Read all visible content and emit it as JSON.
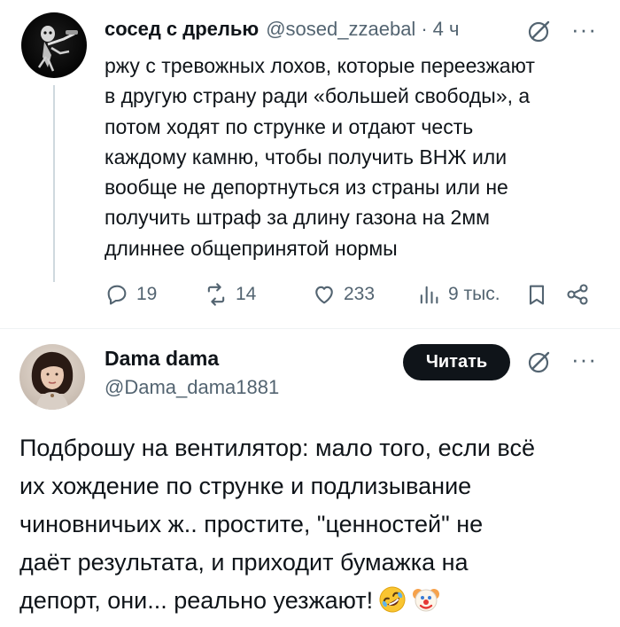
{
  "tweet1": {
    "author_name": "сосед с дрелью",
    "author_handle": "@sosed_zzaebal",
    "separator": "·",
    "time": "4 ч",
    "more_icon": "more-horizontal-icon",
    "grok_icon": "grok-icon",
    "text_lines": [
      "ржу с тревожных лохов, которые переезжают",
      "в другую страну ради «большей свободы», а",
      "потом ходят по струнке и отдают честь",
      "каждому камню, чтобы получить ВНЖ или",
      "вообще не депортнуться из страны или не",
      "получить штраф за длину газона на 2мм",
      "длиннее общепринятой нормы"
    ],
    "actions": {
      "replies": "19",
      "reposts": "14",
      "likes": "233",
      "views": "9 тыс."
    }
  },
  "tweet2": {
    "author_name": "Dama dama",
    "author_handle": "@Dama_dama1881",
    "follow_label": "Читать",
    "text_lines": [
      "Подброшу на вентилятор: мало того, если всё",
      "их хождение по струнке и подлизывание",
      "чиновничьих ж.. простите, \"ценностей\" не",
      "даёт результата, и приходит бумажка на",
      "депорт, они... реально уезжают!"
    ],
    "emojis": [
      "rolling-on-floor-laughing-emoji",
      "clown-face-emoji"
    ]
  },
  "colors": {
    "text": "#0f1419",
    "secondary": "#536471",
    "button_bg": "#0f1419",
    "button_text": "#ffffff",
    "divider": "#eff3f4"
  }
}
